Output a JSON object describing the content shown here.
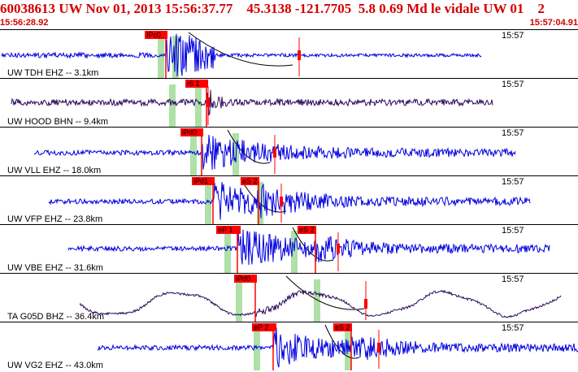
{
  "header": {
    "title": "60038613 UW Nov 01, 2013 15:56:37.77    45.3138 -121.7705  5.8 0.69 Md le vidale UW 01    2",
    "start_time": "15:56:28.92",
    "end_time": "15:57:04.91"
  },
  "colors": {
    "title": "#d40000",
    "trace_blue": "#0000e0",
    "trace_purple": "#2a0a5a",
    "pick_box": "#ff0000",
    "pick_window": "#aee0a8",
    "arrival_curve": "#000000",
    "marker_red": "#ff0000"
  },
  "panels": [
    {
      "station": "UW TDH EHZ -- 3.1km",
      "time": "15:57",
      "trace": "blue",
      "style": "burst-small",
      "p_pick": "IPc0",
      "s_pick": ""
    },
    {
      "station": "UW HOOD BHN -- 9.4km",
      "time": "15:57",
      "trace": "purple",
      "style": "steady",
      "p_pick": "iS 1",
      "s_pick": ""
    },
    {
      "station": "UW VLL EHZ -- 18.0km",
      "time": "15:57",
      "trace": "blue",
      "style": "burst",
      "p_pick": "iPd0",
      "s_pick": ""
    },
    {
      "station": "UW VFP EHZ -- 23.8km",
      "time": "15:57",
      "trace": "blue",
      "style": "burst",
      "p_pick": "iPd1",
      "s_pick": "eS 2"
    },
    {
      "station": "UW VBE EHZ -- 31.6km",
      "time": "15:57",
      "trace": "blue",
      "style": "burst",
      "p_pick": "eP 1",
      "s_pick": "eS 2"
    },
    {
      "station": "TA G05D BHZ -- 36.4km",
      "time": "15:57",
      "trace": "purple",
      "style": "wave",
      "p_pick": "iPd0",
      "s_pick": ""
    },
    {
      "station": "UW VG2 EHZ -- 43.0km",
      "time": "15:57",
      "trace": "blue",
      "style": "burst",
      "p_pick": "eP 2",
      "s_pick": "eS 2"
    }
  ]
}
